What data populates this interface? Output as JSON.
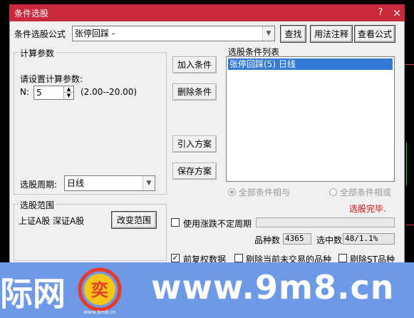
{
  "window": {
    "title": "条件选股",
    "help_glyph": "?",
    "close_glyph": "×"
  },
  "formula": {
    "label": "条件选股公式",
    "value": "张停回踩        -",
    "find_button": "查找",
    "usage_button": "用法注释",
    "view_button": "查看公式"
  },
  "params": {
    "group_title": "计算参数",
    "prompt": "请设置计算参数:",
    "n_label": "N:",
    "n_value": "5",
    "n_range": "(2.00--20.00)"
  },
  "period": {
    "label": "选股周期:",
    "value": "日线"
  },
  "actions": {
    "add": "加入条件",
    "delete": "删除条件",
    "import": "引入方案",
    "save": "保存方案"
  },
  "conditions": {
    "title": "选股条件列表",
    "items": [
      "张停回踩(5) 日线"
    ]
  },
  "logic": {
    "all_and": "全部条件相与",
    "all_or": "全部条件相或",
    "status": "选股完毕.",
    "status_color": "#d01010"
  },
  "range": {
    "group_title": "选股范围",
    "value": "上证A股 深证A股",
    "change_button": "改变范围"
  },
  "options": {
    "use_variable_period": "使用涨跌不定周期",
    "pre_adjust": "前复权数据",
    "exclude_suspended": "剔除当前未交易的品种",
    "exclude_st": "剔除ST品种"
  },
  "stats": {
    "count_label": "品种数",
    "count_value": "4365",
    "selected_label": "选中数",
    "selected_value": "48/1.1%"
  },
  "watermark": {
    "left_text": "际网",
    "url": "www.9m8.cn",
    "logo_small": "www.9m8.cn",
    "logo_char": "奕"
  },
  "colors": {
    "titlebar": "#c9293a",
    "banner": "#6e99e6",
    "selection": "#3379d6"
  }
}
